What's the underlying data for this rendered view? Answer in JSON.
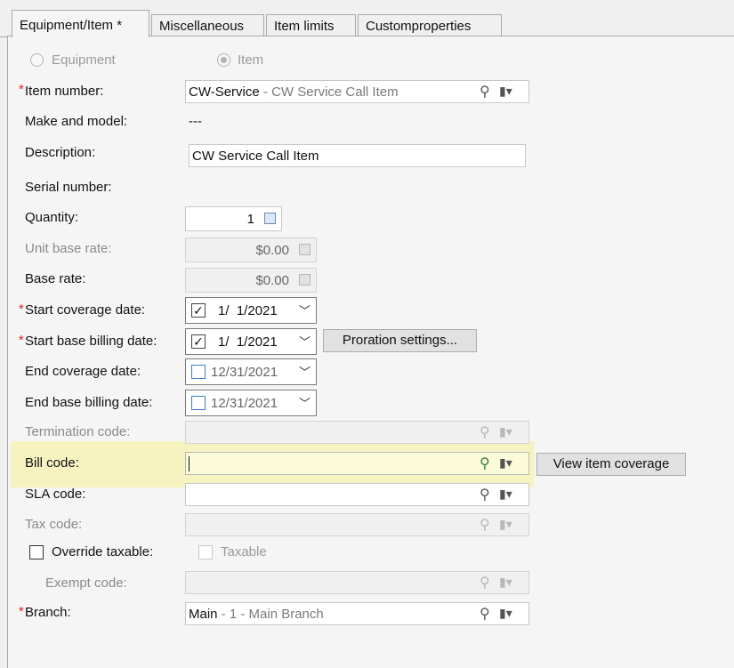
{
  "tabs": [
    {
      "label": "Equipment/Item *"
    },
    {
      "label": "Miscellaneous"
    },
    {
      "label": "Item limits"
    },
    {
      "label": "Customproperties"
    }
  ],
  "type_options": {
    "equipment": "Equipment",
    "item": "Item"
  },
  "fields": {
    "item_number": {
      "label": "Item number:",
      "value": "CW-Service",
      "sub": " - CW Service Call Item"
    },
    "make_model": {
      "label": "Make and model:",
      "value": "---"
    },
    "description": {
      "label": "Description:",
      "value": "CW Service Call Item"
    },
    "serial": {
      "label": "Serial number:"
    },
    "quantity": {
      "label": "Quantity:",
      "value": "1"
    },
    "unit_base_rate": {
      "label": "Unit base rate:",
      "value": "$0.00"
    },
    "base_rate": {
      "label": "Base rate:",
      "value": "$0.00"
    },
    "start_coverage": {
      "label": "Start coverage date:",
      "value": "1/  1/2021",
      "checked": true
    },
    "start_billing": {
      "label": "Start base billing date:",
      "value": "1/  1/2021",
      "checked": true
    },
    "end_coverage": {
      "label": "End coverage date:",
      "value": "12/31/2021",
      "checked": false
    },
    "end_billing": {
      "label": "End base billing date:",
      "value": "12/31/2021",
      "checked": false
    },
    "termination": {
      "label": "Termination code:",
      "value": ""
    },
    "bill_code": {
      "label": "Bill code:",
      "value": ""
    },
    "sla_code": {
      "label": "SLA code:",
      "value": ""
    },
    "tax_code": {
      "label": "Tax code:",
      "value": ""
    },
    "override_taxable": {
      "label": "Override taxable:"
    },
    "taxable": {
      "label": "Taxable"
    },
    "exempt_code": {
      "label": "Exempt code:",
      "value": ""
    },
    "branch": {
      "label": "Branch:",
      "value": "Main",
      "sub": " - 1 - Main Branch"
    }
  },
  "buttons": {
    "proration": "Proration settings...",
    "view_coverage": "View item coverage"
  },
  "required_mark": "*",
  "icons": {
    "lookup": "magnifier-icon",
    "options": "options-dropdown-icon",
    "calculator": "calculator-icon",
    "chevron": "chevron-down-icon"
  },
  "colors": {
    "required": "#d9261c",
    "highlight": "#f5f08f"
  }
}
